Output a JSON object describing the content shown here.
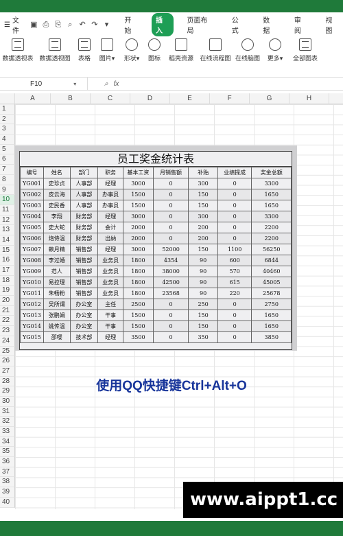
{
  "menubar": {
    "file_label": "文件",
    "tabs": [
      "开始",
      "插入",
      "页面布局",
      "公式",
      "数据",
      "审阅",
      "视图"
    ],
    "active_tab": "插入"
  },
  "ribbon": {
    "items": [
      "数据透视表",
      "数据透视图",
      "表格",
      "图片▾",
      "形状▾",
      "图标",
      "稻壳资源",
      "在线流程图",
      "在线脑图",
      "更多▾",
      "全部图表"
    ]
  },
  "formula_bar": {
    "cell_ref": "F10",
    "fx": "fx",
    "value": ""
  },
  "columns": [
    "A",
    "B",
    "C",
    "D",
    "E",
    "F",
    "G",
    "H"
  ],
  "rows": [
    "1",
    "2",
    "3",
    "4",
    "5",
    "6",
    "7",
    "8",
    "9",
    "10",
    "11",
    "12",
    "13",
    "14",
    "15",
    "16",
    "17",
    "18",
    "19",
    "20",
    "21",
    "22",
    "23",
    "24",
    "25",
    "26",
    "27",
    "28",
    "29",
    "30",
    "31",
    "32",
    "33",
    "34",
    "35",
    "36",
    "37",
    "38",
    "39",
    "40"
  ],
  "selected_row": "10",
  "sheet": {
    "title": "员工奖金统计表",
    "headers": [
      "编号",
      "姓名",
      "部门",
      "职务",
      "基本工资",
      "月销售额",
      "补贴",
      "业绩提成",
      "奖金总额"
    ],
    "rows": [
      [
        "YG001",
        "史珍贞",
        "人事部",
        "经理",
        "3000",
        "0",
        "300",
        "0",
        "3300"
      ],
      [
        "YG002",
        "皮云海",
        "人事部",
        "办事员",
        "1500",
        "0",
        "150",
        "0",
        "1650"
      ],
      [
        "YG003",
        "史民香",
        "人事部",
        "办事员",
        "1500",
        "0",
        "150",
        "0",
        "1650"
      ],
      [
        "YG004",
        "李翔",
        "财务部",
        "经理",
        "3000",
        "0",
        "300",
        "0",
        "3300"
      ],
      [
        "YG005",
        "史大蛇",
        "财务部",
        "会计",
        "2000",
        "0",
        "200",
        "0",
        "2200"
      ],
      [
        "YG006",
        "炮侍温",
        "财务部",
        "出纳",
        "2000",
        "0",
        "200",
        "0",
        "2200"
      ],
      [
        "YG007",
        "赖月精",
        "销售部",
        "经理",
        "3000",
        "52000",
        "150",
        "1100",
        "56250"
      ],
      [
        "YG008",
        "李过婚",
        "销售部",
        "业务员",
        "1800",
        "4354",
        "90",
        "600",
        "6844"
      ],
      [
        "YG009",
        "范人",
        "销售部",
        "业务员",
        "1800",
        "38000",
        "90",
        "570",
        "40460"
      ],
      [
        "YG010",
        "易拉理",
        "销售部",
        "业务员",
        "1800",
        "42500",
        "90",
        "615",
        "45005"
      ],
      [
        "YG011",
        "朱畅粉",
        "销售部",
        "业务员",
        "1800",
        "23568",
        "90",
        "220",
        "25678"
      ],
      [
        "YG012",
        "吴所谓",
        "办公室",
        "主任",
        "2500",
        "0",
        "250",
        "0",
        "2750"
      ],
      [
        "YG013",
        "张鹏娟",
        "办公室",
        "干事",
        "1500",
        "0",
        "150",
        "0",
        "1650"
      ],
      [
        "YG014",
        "姚传温",
        "办公室",
        "干事",
        "1500",
        "0",
        "150",
        "0",
        "1650"
      ],
      [
        "YG015",
        "邵嘤",
        "技术部",
        "经理",
        "3500",
        "0",
        "350",
        "0",
        "3850"
      ]
    ]
  },
  "caption": "使用QQ快捷键Ctrl+Alt+O",
  "watermark": "www.aippt1.cc"
}
